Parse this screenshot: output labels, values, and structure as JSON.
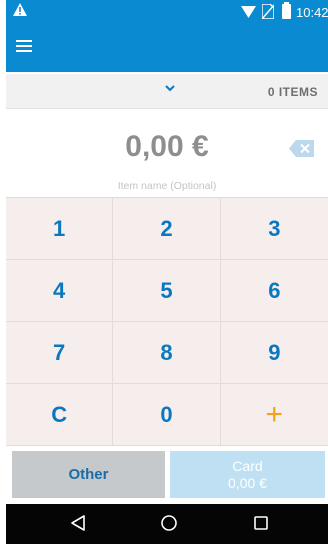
{
  "status_bar": {
    "time": "10:42",
    "icons": [
      "warning-icon",
      "wifi-icon",
      "no-sim-icon",
      "battery-icon"
    ]
  },
  "app_bar": {
    "menu_icon": "hamburger-menu-icon"
  },
  "filter_bar": {
    "dropdown_icon": "chevron-down-icon",
    "items_count": "0 ITEMS"
  },
  "amount": {
    "value": "0,00 €",
    "backspace_icon": "backspace-icon"
  },
  "item_name": {
    "placeholder": "Item name (Optional)"
  },
  "keypad": {
    "keys": [
      "1",
      "2",
      "3",
      "4",
      "5",
      "6",
      "7",
      "8",
      "9",
      "C",
      "0",
      "+"
    ]
  },
  "actions": {
    "other_label": "Other",
    "card_label": "Card",
    "card_amount": "0,00 €"
  },
  "nav_bar": {
    "icons": [
      "back-triangle-icon",
      "home-circle-icon",
      "recents-square-icon"
    ]
  },
  "colors": {
    "brand_blue": "#0a8ad0",
    "key_blue": "#0a78c0",
    "plus_orange": "#f0a21a",
    "keypad_bg": "#f6eded"
  }
}
